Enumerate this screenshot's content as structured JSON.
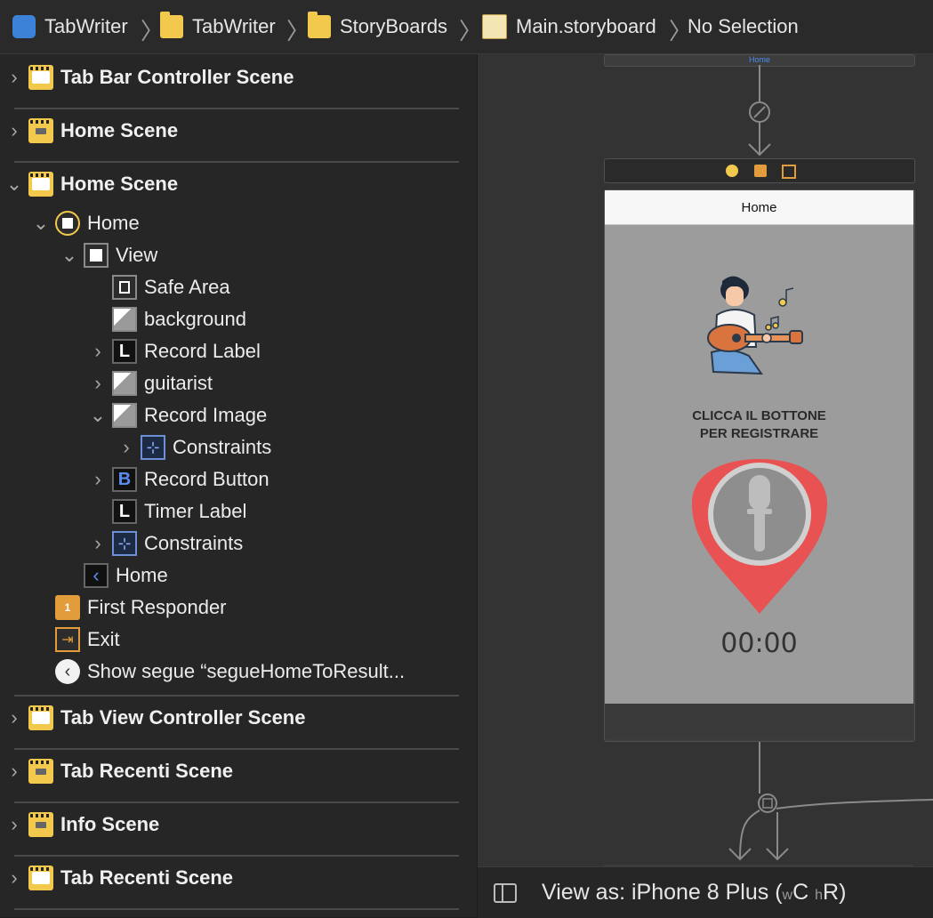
{
  "breadcrumb": {
    "items": [
      {
        "label": "TabWriter",
        "icon": "xcode-project-icon"
      },
      {
        "label": "TabWriter",
        "icon": "folder-icon"
      },
      {
        "label": "StoryBoards",
        "icon": "folder-icon"
      },
      {
        "label": "Main.storyboard",
        "icon": "storyboard-file-icon"
      },
      {
        "label": "No Selection",
        "icon": ""
      }
    ]
  },
  "outline": {
    "scene_tab_bar": "Tab Bar Controller Scene",
    "scene_home_1": "Home Scene",
    "scene_home_2": "Home Scene",
    "home_vc": "Home",
    "view": "View",
    "safe_area": "Safe Area",
    "background": "background",
    "record_label": "Record Label",
    "guitarist": "guitarist",
    "record_image": "Record Image",
    "constraints_inner": "Constraints",
    "record_button": "Record Button",
    "timer_label": "Timer Label",
    "constraints_view": "Constraints",
    "home_nav_item": "Home",
    "first_responder": "First Responder",
    "exit": "Exit",
    "segue": "Show segue “segueHomeToResult...",
    "scene_tab_view": "Tab View Controller Scene",
    "scene_tab_recenti_1": "Tab Recenti Scene",
    "scene_info": "Info Scene",
    "scene_tab_recenti_2": "Tab Recenti Scene"
  },
  "canvas": {
    "top_scene_label": "Home",
    "nav_title": "Home",
    "caption": "CLICCA IL BOTTONE\nPER REGISTRARE",
    "timer": "00:00"
  },
  "bottom_bar": {
    "prefix": "View as: iPhone 8 Plus (",
    "w": "w",
    "c": "C",
    "h": "h",
    "r": "R",
    "suffix": ")"
  },
  "colors": {
    "scene_icon": "#f2c94c",
    "pick_red": "#e85252",
    "constraint_blue": "#6c8fd6"
  }
}
